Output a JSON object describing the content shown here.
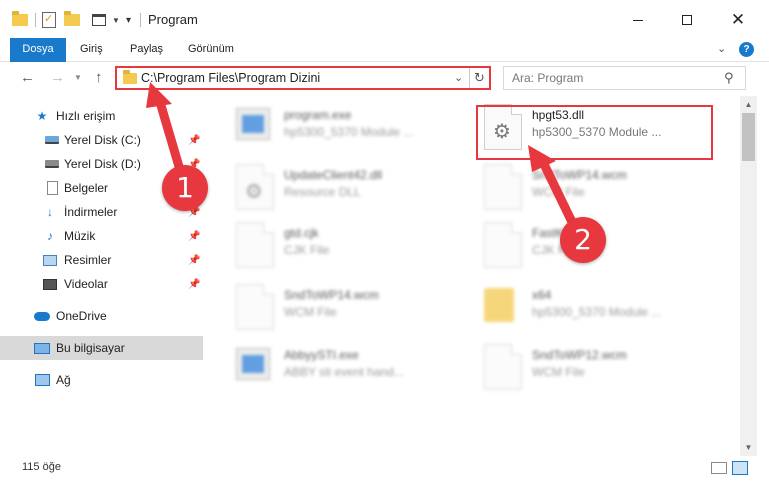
{
  "window": {
    "title": "Program"
  },
  "ribbon": {
    "tabs": [
      {
        "label": "Dosya",
        "active": true
      },
      {
        "label": "Giriş"
      },
      {
        "label": "Paylaş"
      },
      {
        "label": "Görünüm"
      }
    ],
    "help_label": "?"
  },
  "address": {
    "path": "C:\\Program Files\\Program Dizini"
  },
  "search": {
    "placeholder": "Ara: Program"
  },
  "sidebar": {
    "items": [
      {
        "label": "Hızlı erişim",
        "icon": "star-icon"
      },
      {
        "label": "Yerel Disk (C:)",
        "icon": "disk-icon",
        "pinned": true
      },
      {
        "label": "Yerel Disk (D:)",
        "icon": "disk-icon",
        "pinned": true
      },
      {
        "label": "Belgeler",
        "icon": "document-icon",
        "pinned": true
      },
      {
        "label": "İndirmeler",
        "icon": "download-icon",
        "pinned": true
      },
      {
        "label": "Müzik",
        "icon": "music-icon",
        "pinned": true
      },
      {
        "label": "Resimler",
        "icon": "pictures-icon",
        "pinned": true
      },
      {
        "label": "Videolar",
        "icon": "videos-icon",
        "pinned": true
      },
      {
        "label": "OneDrive",
        "icon": "onedrive-icon"
      },
      {
        "label": "Bu bilgisayar",
        "icon": "computer-icon",
        "selected": true
      },
      {
        "label": "Ağ",
        "icon": "network-icon"
      }
    ]
  },
  "files": [
    {
      "name": "program.exe",
      "desc": "hp5300_5370 Module ...",
      "icon": "exe-icon"
    },
    {
      "name": "hpgt53.dll",
      "desc": "hp5300_5370 Module ...",
      "icon": "dll-icon",
      "highlighted": true
    },
    {
      "name": "UpdateClient42.dll",
      "desc": "Resource DLL",
      "icon": "dll-icon"
    },
    {
      "name": "SndToWP14.wcm",
      "desc": "WCM File",
      "icon": "file-icon"
    },
    {
      "name": "gtd.cjk",
      "desc": "CJK File",
      "icon": "file-icon"
    },
    {
      "name": "FastK...",
      "desc": "CJK File",
      "icon": "file-icon"
    },
    {
      "name": "SndToWP14.wcm",
      "desc": "WCM File",
      "icon": "file-icon"
    },
    {
      "name": "x64",
      "desc": "hp5300_5370 Module ...",
      "icon": "folder-icon"
    },
    {
      "name": "AbbyySTI.exe",
      "desc": "ABBY sti event hand...",
      "icon": "exe-icon"
    },
    {
      "name": "SndToWP12.wcm",
      "desc": "WCM File",
      "icon": "file-icon"
    }
  ],
  "status": {
    "item_count": "115 öğe"
  },
  "callouts": {
    "one": "1",
    "two": "2"
  },
  "colors": {
    "accent": "#1979ca",
    "annotation_red": "#e8383f",
    "selection_gray": "#d9d9d9"
  }
}
